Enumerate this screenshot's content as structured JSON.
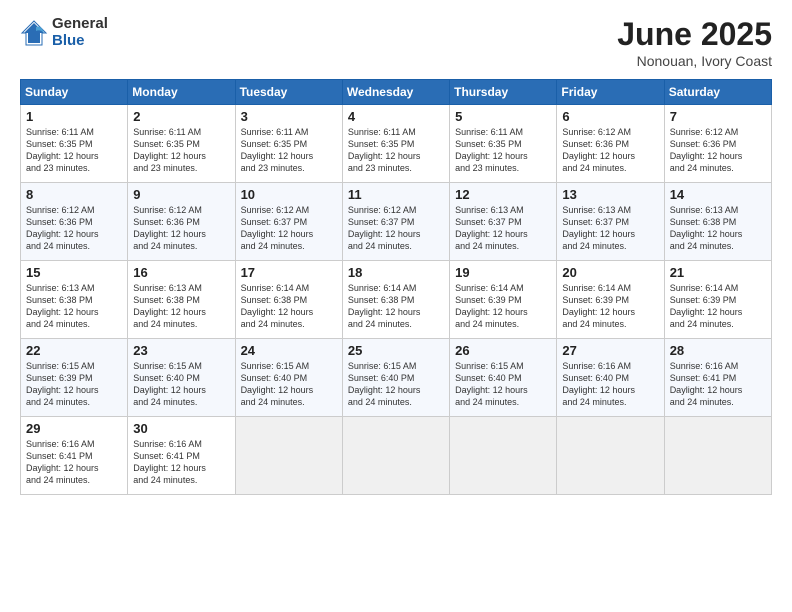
{
  "header": {
    "logo_general": "General",
    "logo_blue": "Blue",
    "title": "June 2025",
    "subtitle": "Nonouan, Ivory Coast"
  },
  "weekdays": [
    "Sunday",
    "Monday",
    "Tuesday",
    "Wednesday",
    "Thursday",
    "Friday",
    "Saturday"
  ],
  "weeks": [
    [
      {
        "day": "1",
        "lines": [
          "Sunrise: 6:11 AM",
          "Sunset: 6:35 PM",
          "Daylight: 12 hours",
          "and 23 minutes."
        ]
      },
      {
        "day": "2",
        "lines": [
          "Sunrise: 6:11 AM",
          "Sunset: 6:35 PM",
          "Daylight: 12 hours",
          "and 23 minutes."
        ]
      },
      {
        "day": "3",
        "lines": [
          "Sunrise: 6:11 AM",
          "Sunset: 6:35 PM",
          "Daylight: 12 hours",
          "and 23 minutes."
        ]
      },
      {
        "day": "4",
        "lines": [
          "Sunrise: 6:11 AM",
          "Sunset: 6:35 PM",
          "Daylight: 12 hours",
          "and 23 minutes."
        ]
      },
      {
        "day": "5",
        "lines": [
          "Sunrise: 6:11 AM",
          "Sunset: 6:35 PM",
          "Daylight: 12 hours",
          "and 23 minutes."
        ]
      },
      {
        "day": "6",
        "lines": [
          "Sunrise: 6:12 AM",
          "Sunset: 6:36 PM",
          "Daylight: 12 hours",
          "and 24 minutes."
        ]
      },
      {
        "day": "7",
        "lines": [
          "Sunrise: 6:12 AM",
          "Sunset: 6:36 PM",
          "Daylight: 12 hours",
          "and 24 minutes."
        ]
      }
    ],
    [
      {
        "day": "8",
        "lines": [
          "Sunrise: 6:12 AM",
          "Sunset: 6:36 PM",
          "Daylight: 12 hours",
          "and 24 minutes."
        ]
      },
      {
        "day": "9",
        "lines": [
          "Sunrise: 6:12 AM",
          "Sunset: 6:36 PM",
          "Daylight: 12 hours",
          "and 24 minutes."
        ]
      },
      {
        "day": "10",
        "lines": [
          "Sunrise: 6:12 AM",
          "Sunset: 6:37 PM",
          "Daylight: 12 hours",
          "and 24 minutes."
        ]
      },
      {
        "day": "11",
        "lines": [
          "Sunrise: 6:12 AM",
          "Sunset: 6:37 PM",
          "Daylight: 12 hours",
          "and 24 minutes."
        ]
      },
      {
        "day": "12",
        "lines": [
          "Sunrise: 6:13 AM",
          "Sunset: 6:37 PM",
          "Daylight: 12 hours",
          "and 24 minutes."
        ]
      },
      {
        "day": "13",
        "lines": [
          "Sunrise: 6:13 AM",
          "Sunset: 6:37 PM",
          "Daylight: 12 hours",
          "and 24 minutes."
        ]
      },
      {
        "day": "14",
        "lines": [
          "Sunrise: 6:13 AM",
          "Sunset: 6:38 PM",
          "Daylight: 12 hours",
          "and 24 minutes."
        ]
      }
    ],
    [
      {
        "day": "15",
        "lines": [
          "Sunrise: 6:13 AM",
          "Sunset: 6:38 PM",
          "Daylight: 12 hours",
          "and 24 minutes."
        ]
      },
      {
        "day": "16",
        "lines": [
          "Sunrise: 6:13 AM",
          "Sunset: 6:38 PM",
          "Daylight: 12 hours",
          "and 24 minutes."
        ]
      },
      {
        "day": "17",
        "lines": [
          "Sunrise: 6:14 AM",
          "Sunset: 6:38 PM",
          "Daylight: 12 hours",
          "and 24 minutes."
        ]
      },
      {
        "day": "18",
        "lines": [
          "Sunrise: 6:14 AM",
          "Sunset: 6:38 PM",
          "Daylight: 12 hours",
          "and 24 minutes."
        ]
      },
      {
        "day": "19",
        "lines": [
          "Sunrise: 6:14 AM",
          "Sunset: 6:39 PM",
          "Daylight: 12 hours",
          "and 24 minutes."
        ]
      },
      {
        "day": "20",
        "lines": [
          "Sunrise: 6:14 AM",
          "Sunset: 6:39 PM",
          "Daylight: 12 hours",
          "and 24 minutes."
        ]
      },
      {
        "day": "21",
        "lines": [
          "Sunrise: 6:14 AM",
          "Sunset: 6:39 PM",
          "Daylight: 12 hours",
          "and 24 minutes."
        ]
      }
    ],
    [
      {
        "day": "22",
        "lines": [
          "Sunrise: 6:15 AM",
          "Sunset: 6:39 PM",
          "Daylight: 12 hours",
          "and 24 minutes."
        ]
      },
      {
        "day": "23",
        "lines": [
          "Sunrise: 6:15 AM",
          "Sunset: 6:40 PM",
          "Daylight: 12 hours",
          "and 24 minutes."
        ]
      },
      {
        "day": "24",
        "lines": [
          "Sunrise: 6:15 AM",
          "Sunset: 6:40 PM",
          "Daylight: 12 hours",
          "and 24 minutes."
        ]
      },
      {
        "day": "25",
        "lines": [
          "Sunrise: 6:15 AM",
          "Sunset: 6:40 PM",
          "Daylight: 12 hours",
          "and 24 minutes."
        ]
      },
      {
        "day": "26",
        "lines": [
          "Sunrise: 6:15 AM",
          "Sunset: 6:40 PM",
          "Daylight: 12 hours",
          "and 24 minutes."
        ]
      },
      {
        "day": "27",
        "lines": [
          "Sunrise: 6:16 AM",
          "Sunset: 6:40 PM",
          "Daylight: 12 hours",
          "and 24 minutes."
        ]
      },
      {
        "day": "28",
        "lines": [
          "Sunrise: 6:16 AM",
          "Sunset: 6:41 PM",
          "Daylight: 12 hours",
          "and 24 minutes."
        ]
      }
    ],
    [
      {
        "day": "29",
        "lines": [
          "Sunrise: 6:16 AM",
          "Sunset: 6:41 PM",
          "Daylight: 12 hours",
          "and 24 minutes."
        ]
      },
      {
        "day": "30",
        "lines": [
          "Sunrise: 6:16 AM",
          "Sunset: 6:41 PM",
          "Daylight: 12 hours",
          "and 24 minutes."
        ]
      },
      {
        "day": "",
        "lines": []
      },
      {
        "day": "",
        "lines": []
      },
      {
        "day": "",
        "lines": []
      },
      {
        "day": "",
        "lines": []
      },
      {
        "day": "",
        "lines": []
      }
    ]
  ]
}
